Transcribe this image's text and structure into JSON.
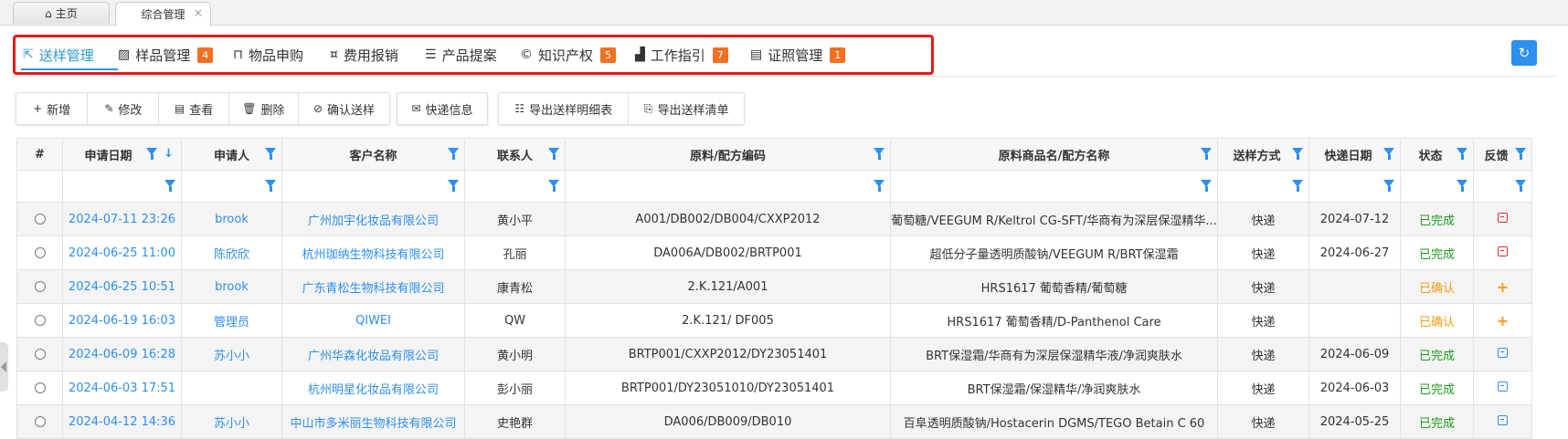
{
  "window_tabs": [
    {
      "label": "主页",
      "icon": "home-icon"
    },
    {
      "label": "综合管理",
      "close": "×"
    }
  ],
  "module_tabs": [
    {
      "label": "送样管理",
      "icon": "external-link-icon"
    },
    {
      "label": "样品管理",
      "icon": "image-icon",
      "badge": "4"
    },
    {
      "label": "物品申购",
      "icon": "shopping-bag-icon"
    },
    {
      "label": "费用报销",
      "icon": "money-icon"
    },
    {
      "label": "产品提案",
      "icon": "list-icon"
    },
    {
      "label": "知识产权",
      "icon": "copyright-icon",
      "badge": "5"
    },
    {
      "label": "工作指引",
      "icon": "bar-chart-icon",
      "badge": "7"
    },
    {
      "label": "证照管理",
      "icon": "certificate-icon",
      "badge": "1"
    }
  ],
  "toolbar": {
    "add": "新增",
    "edit": "修改",
    "view": "查看",
    "delete": "删除",
    "confirm": "确认送样",
    "express": "快递信息",
    "export_detail": "导出送样明细表",
    "export_list": "导出送样清单"
  },
  "table": {
    "headers": {
      "idx": "#",
      "date": "申请日期",
      "applicant": "申请人",
      "customer": "客户名称",
      "contact": "联系人",
      "code": "原料/配方编码",
      "name": "原料商品名/配方名称",
      "method": "送样方式",
      "exp_date": "快递日期",
      "status": "状态",
      "feedback": "反馈"
    },
    "rows": [
      {
        "date": "2024-07-11 23:26",
        "applicant": "brook",
        "customer": "广州加宇化妆品有限公司",
        "contact": "黄小平",
        "code": "A001/DB002/DB004/CXXP2012",
        "name": "葡萄糖/VEEGUM R/Keltrol CG-SFT/华商有为深层保湿精华...",
        "method": "快递",
        "exp_date": "2024-07-12",
        "status": "已完成",
        "feedback": "red"
      },
      {
        "date": "2024-06-25 11:00",
        "applicant": "陈欣欣",
        "customer": "杭州珈纳生物科技有限公司",
        "contact": "孔丽",
        "code": "DA006A/DB002/BRTP001",
        "name": "超低分子量透明质酸钠/VEEGUM R/BRT保湿霜",
        "method": "快递",
        "exp_date": "2024-06-27",
        "status": "已完成",
        "feedback": "red"
      },
      {
        "date": "2024-06-25 10:51",
        "applicant": "brook",
        "customer": "广东青松生物科技有限公司",
        "contact": "康青松",
        "code": "2.K.121/A001",
        "name": "HRS1617 葡萄香精/葡萄糖",
        "method": "快递",
        "exp_date": "",
        "status": "已确认",
        "feedback": "plus"
      },
      {
        "date": "2024-06-19 16:03",
        "applicant": "管理员",
        "customer": "QIWEI",
        "contact": "QW",
        "code": "2.K.121/ DF005",
        "name": "HRS1617 葡萄香精/D-Panthenol Care",
        "method": "快递",
        "exp_date": "",
        "status": "已确认",
        "feedback": "plus"
      },
      {
        "date": "2024-06-09 16:28",
        "applicant": "苏小小",
        "customer": "广州华森化妆品有限公司",
        "contact": "黄小明",
        "code": "BRTP001/CXXP2012/DY23051401",
        "name": "BRT保湿霜/华商有为深层保湿精华液/净润爽肤水",
        "method": "快递",
        "exp_date": "2024-06-09",
        "status": "已完成",
        "feedback": "blue"
      },
      {
        "date": "2024-06-03 17:51",
        "applicant": "",
        "customer": "杭州明星化妆品有限公司",
        "contact": "彭小丽",
        "code": "BRTP001/DY23051010/DY23051401",
        "name": "BRT保湿霜/保湿精华/净润爽肤水",
        "method": "快递",
        "exp_date": "2024-06-03",
        "status": "已完成",
        "feedback": "blue"
      },
      {
        "date": "2024-04-12 14:36",
        "applicant": "苏小小",
        "customer": "中山市多米丽生物科技有限公司",
        "contact": "史艳群",
        "code": "DA006/DB009/DB010",
        "name": "百阜透明质酸钠/Hostacerin DGMS/TEGO Betain C 60",
        "method": "快递",
        "exp_date": "2024-05-25",
        "status": "已完成",
        "feedback": "blue"
      }
    ]
  },
  "colors": {
    "accent": "#2d9ad2",
    "badge": "#f37021",
    "done": "#1a9b1a",
    "confirmed": "#f39c12",
    "highlight_box": "#e61a1a"
  }
}
